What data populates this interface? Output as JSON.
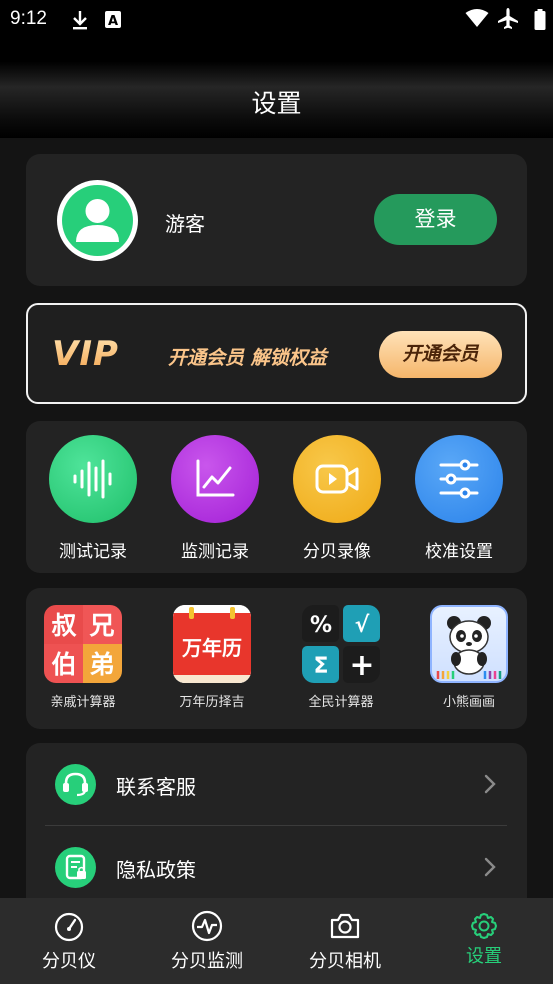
{
  "status_bar": {
    "time": "9:12"
  },
  "header": {
    "title": "设置"
  },
  "profile": {
    "name": "游客",
    "login_label": "登录"
  },
  "vip": {
    "logo": "VIP",
    "slogan": "开通会员 解锁权益",
    "button_label": "开通会员"
  },
  "features": [
    {
      "label": "测试记录",
      "icon": "waveform-icon",
      "color": "#27cf7a"
    },
    {
      "label": "监测记录",
      "icon": "line-chart-icon",
      "color": "#b231e0"
    },
    {
      "label": "分贝录像",
      "icon": "video-camera-icon",
      "color": "#f2b21f"
    },
    {
      "label": "校准设置",
      "icon": "sliders-icon",
      "color": "#2d8cf0"
    }
  ],
  "apps": [
    {
      "label": "亲戚计算器",
      "glyphs": [
        "叔",
        "兄",
        "伯",
        "弟"
      ]
    },
    {
      "label": "万年历择吉",
      "glyphs": [
        "万年历"
      ]
    },
    {
      "label": "全民计算器",
      "glyphs": [
        "%",
        "√",
        "Σ",
        "+"
      ]
    },
    {
      "label": "小熊画画",
      "glyphs": []
    }
  ],
  "settings_list": [
    {
      "label": "联系客服",
      "icon": "headset-icon"
    },
    {
      "label": "隐私政策",
      "icon": "privacy-document-icon"
    }
  ],
  "bottom_nav": [
    {
      "label": "分贝仪",
      "icon": "gauge-icon",
      "active": false
    },
    {
      "label": "分贝监测",
      "icon": "pulse-icon",
      "active": false
    },
    {
      "label": "分贝相机",
      "icon": "camera-icon",
      "active": false
    },
    {
      "label": "设置",
      "icon": "gear-icon",
      "active": true
    }
  ],
  "colors": {
    "accent": "#27cf7a",
    "login_button": "#259a5c",
    "vip_gold": "#f5b66b",
    "card_bg": "#232323"
  }
}
